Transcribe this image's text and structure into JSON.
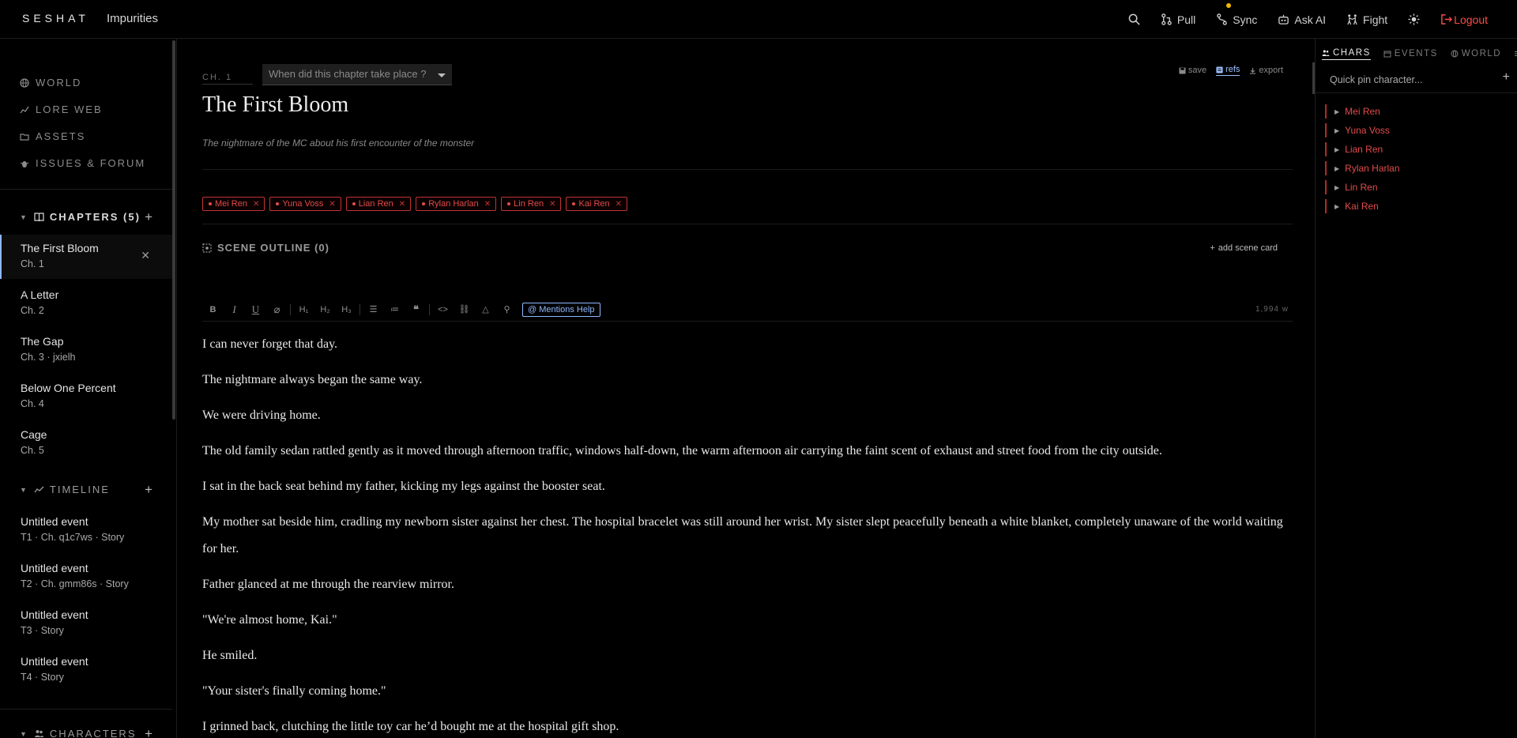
{
  "app": {
    "logo": "SESHAT",
    "project": "Impurities"
  },
  "topnav": [
    {
      "label": "",
      "icon": "search-icon"
    },
    {
      "label": "Pull",
      "icon": "pull-icon"
    },
    {
      "label": "Sync",
      "icon": "sync-icon",
      "status_color": "#f5b800"
    },
    {
      "label": "Ask AI",
      "icon": "robot-icon"
    },
    {
      "label": "Fight",
      "icon": "fight-icon"
    },
    {
      "label": "",
      "icon": "sun-icon"
    },
    {
      "label": "Logout",
      "icon": "logout-icon",
      "color": "#ff4a4a"
    }
  ],
  "sidebar": {
    "nav": [
      {
        "label": "WORLD",
        "icon": "globe-icon"
      },
      {
        "label": "LORE WEB",
        "icon": "graph-icon"
      },
      {
        "label": "ASSETS",
        "icon": "folder-icon"
      },
      {
        "label": "ISSUES & FORUM",
        "icon": "bug-icon"
      }
    ],
    "chapters_label": "CHAPTERS (5)",
    "chapters": [
      {
        "title": "The First Bloom",
        "meta": "Ch. 1",
        "selected": true
      },
      {
        "title": "A Letter",
        "meta": "Ch. 2"
      },
      {
        "title": "The Gap",
        "meta": "Ch. 3 · jxielh"
      },
      {
        "title": "Below One Percent",
        "meta": "Ch. 4"
      },
      {
        "title": "Cage",
        "meta": "Ch. 5"
      }
    ],
    "timeline_label": "TIMELINE",
    "events": [
      {
        "title": "Untitled event",
        "meta": "T1 · Ch. q1c7ws · Story"
      },
      {
        "title": "Untitled event",
        "meta": "T2 · Ch. gmm86s · Story"
      },
      {
        "title": "Untitled event",
        "meta": "T3 · Story"
      },
      {
        "title": "Untitled event",
        "meta": "T4 · Story"
      }
    ],
    "characters_label": "CHARACTERS"
  },
  "editor": {
    "chapter_label": "CH. 1",
    "when_placeholder": "When did this chapter take place ?",
    "actions": [
      {
        "label": "save",
        "icon": "save-icon"
      },
      {
        "label": "refs",
        "icon": "refs-icon",
        "active": true
      },
      {
        "label": "export",
        "icon": "export-icon"
      }
    ],
    "title": "The First Bloom",
    "subtitle": "The nightmare of the MC about his first encounter of the monster",
    "tags": [
      "Mei Ren",
      "Yuna Voss",
      "Lian Ren",
      "Rylan Harlan",
      "Lin Ren",
      "Kai Ren"
    ],
    "scene_outline_label": "SCENE OUTLINE (0)",
    "add_scene_label": "add scene card",
    "mentions_help": "@ Mentions Help",
    "word_count": "1,994 w",
    "paragraphs": [
      "I can never forget that day.",
      "The nightmare always began the same way.",
      "We were driving home.",
      "The old family sedan rattled gently as it moved through afternoon traffic, windows half-down, the warm afternoon air carrying the faint scent of exhaust and street food from the city outside.",
      "I sat in the back seat behind my father, kicking my legs against the booster seat.",
      "My mother sat beside him, cradling my newborn sister against her chest. The hospital bracelet was still around her wrist. My sister slept peacefully beneath a white blanket, completely unaware of the world waiting for her.",
      "Father glanced at me through the rearview mirror.",
      "\"We're almost home, Kai.\"",
      "He smiled.",
      "\"Your sister's finally coming home.\"",
      "I grinned back, clutching the little toy car he’d bought me at the hospital gift shop."
    ]
  },
  "rightpanel": {
    "tabs": [
      {
        "label": "CHARS",
        "icon": "people-icon",
        "active": true
      },
      {
        "label": "EVENTS",
        "icon": "calendar-icon"
      },
      {
        "label": "WORLD",
        "icon": "globe-icon"
      },
      {
        "label": "",
        "icon": "menu-icon"
      }
    ],
    "pin_placeholder": "Quick pin character...",
    "pinned": [
      "Mei Ren",
      "Yuna Voss",
      "Lian Ren",
      "Rylan Harlan",
      "Lin Ren",
      "Kai Ren"
    ]
  },
  "colors": {
    "accent": "#8fb8ff",
    "character": "#e24b4b",
    "logout": "#ff4a4a",
    "sync_dot": "#f5b800"
  }
}
